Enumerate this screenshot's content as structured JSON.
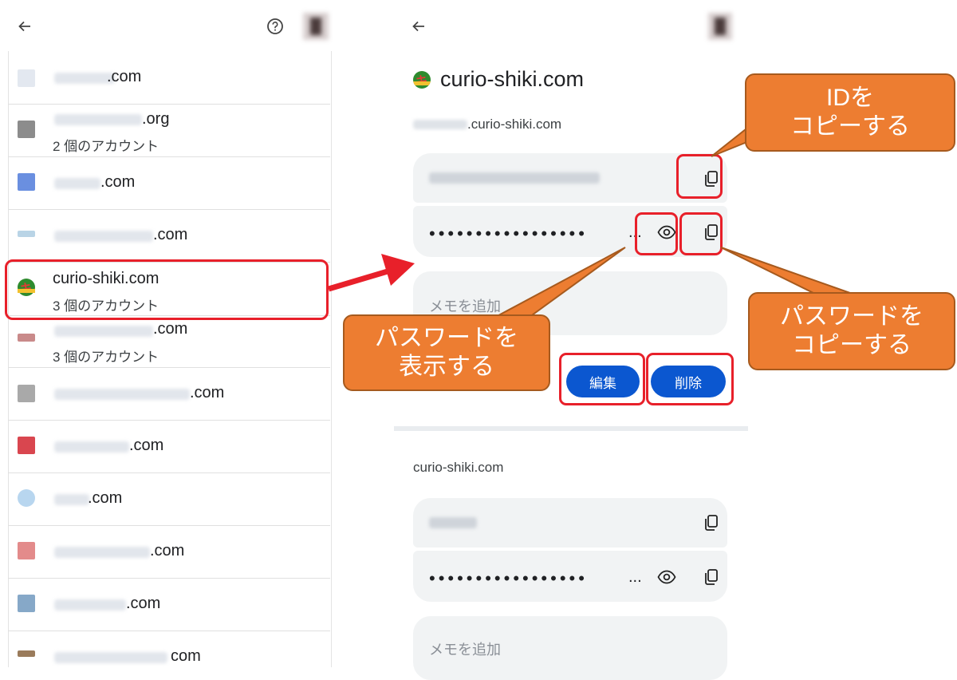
{
  "left_panel": {
    "back_icon": "arrow-left-icon",
    "help_icon": "help-circle-icon",
    "rows": [
      {
        "domain_suffix": ".com",
        "subtitle": "",
        "favicon_color": "#e3e8f0"
      },
      {
        "domain_suffix": ".org",
        "subtitle": "2 個のアカウント",
        "favicon_color": "#8c8c8c"
      },
      {
        "domain_suffix": ".com",
        "subtitle": "",
        "favicon_color": "#6a8fe0"
      },
      {
        "domain_suffix": ".com",
        "subtitle": "",
        "favicon_color": "#b9d4e6"
      },
      {
        "domain_suffix": "curio-shiki.com",
        "subtitle": "3 個のアカウント",
        "favicon_color": "#2e8b2e"
      },
      {
        "domain_suffix": ".com",
        "subtitle": "3 個のアカウント",
        "favicon_color": "#c98a8a"
      },
      {
        "domain_suffix": ".com",
        "subtitle": "",
        "favicon_color": "#a9a9a9"
      },
      {
        "domain_suffix": ".com",
        "subtitle": "",
        "favicon_color": "#d9464f"
      },
      {
        "domain_suffix": ".com",
        "subtitle": "",
        "favicon_color": "#b8d6ef"
      },
      {
        "domain_suffix": ".com",
        "subtitle": "",
        "favicon_color": "#e38b8b"
      },
      {
        "domain_suffix": ".com",
        "subtitle": "",
        "favicon_color": "#86a8c8"
      },
      {
        "domain_suffix": "com",
        "subtitle": "",
        "favicon_color": "#9a7b5b"
      }
    ]
  },
  "right_panel": {
    "back_icon": "arrow-left-icon",
    "site_title": "curio-shiki.com",
    "account1": {
      "origin_suffix": ".curio-shiki.com",
      "password_dots": "•••••••••••••••••",
      "password_more": "...",
      "note_placeholder": "メモを追加",
      "edit_label": "編集",
      "delete_label": "削除"
    },
    "account2": {
      "origin": "curio-shiki.com",
      "password_dots": "•••••••••••••••••",
      "password_more": "...",
      "note_placeholder": "メモを追加"
    }
  },
  "callouts": {
    "copy_id": [
      "IDを",
      "コピーする"
    ],
    "show_password": [
      "パスワードを",
      "表示する"
    ],
    "copy_password": [
      "パスワードを",
      "コピーする"
    ]
  },
  "colors": {
    "accent_blue": "#0b57d0",
    "highlight_red": "#e8202a",
    "callout_orange": "#ed7d31"
  }
}
